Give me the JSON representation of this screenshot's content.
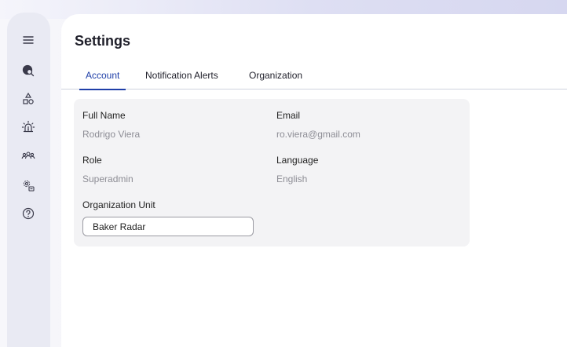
{
  "page": {
    "title": "Settings"
  },
  "sidebar": {
    "icons": [
      "menu-icon",
      "globe-search-icon",
      "shapes-icon",
      "alarm-icon",
      "team-icon",
      "gear-cluster-icon",
      "help-icon"
    ]
  },
  "tabs": [
    {
      "label": "Account",
      "active": true
    },
    {
      "label": "Notification Alerts",
      "active": false
    },
    {
      "label": "Organization",
      "active": false
    }
  ],
  "account": {
    "full_name_label": "Full Name",
    "full_name_value": "Rodrigo Viera",
    "email_label": "Email",
    "email_value": "ro.viera@gmail.com",
    "role_label": "Role",
    "role_value": "Superadmin",
    "language_label": "Language",
    "language_value": "English",
    "org_unit_label": "Organization Unit",
    "org_unit_value": "Baker Radar"
  },
  "colors": {
    "accent": "#1f3fa8",
    "sidebar": "#e9eaf3",
    "card": "#f3f3f5"
  }
}
